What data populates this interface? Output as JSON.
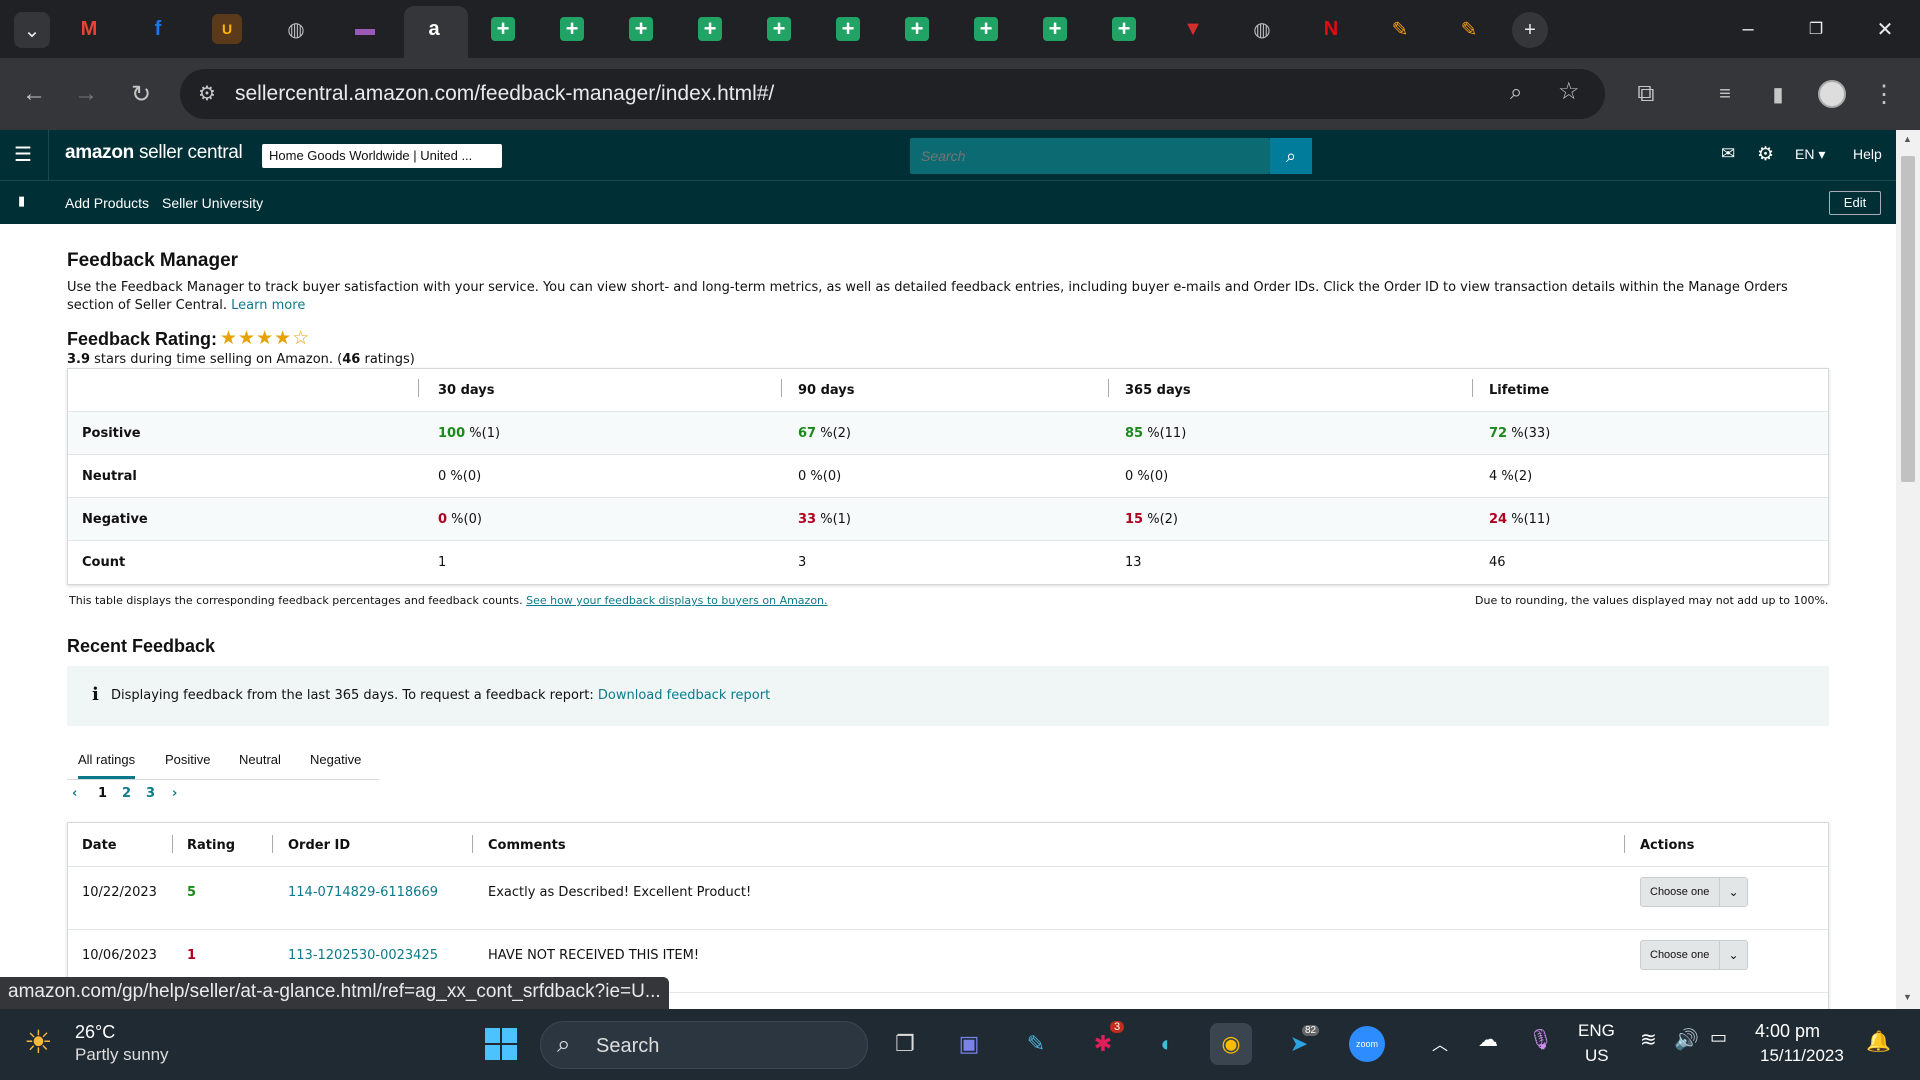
{
  "browser": {
    "url": "sellercentral.amazon.com/feedback-manager/index.html#/",
    "tabs": [
      "gmail-icon",
      "facebook-icon",
      "ups-icon",
      "globe-icon",
      "flag-icon",
      "amazon-icon",
      "sheets-icon",
      "sheets-icon",
      "sheets-icon",
      "sheets-icon",
      "sheets-icon",
      "sheets-icon",
      "sheets-icon",
      "sheets-icon",
      "sheets-icon",
      "sheets-icon",
      "bank-icon",
      "globe-icon",
      "netflix-icon",
      "pen-icon",
      "pen-icon"
    ],
    "colors": {
      "tabstrip": "#202124",
      "toolbar": "#35363a",
      "sheets": "#21a366"
    }
  },
  "header": {
    "logo_amazon": "amazon",
    "logo_suffix": "seller central",
    "store": "Home Goods Worldwide | United ...",
    "search_placeholder": "Search",
    "language": "EN",
    "help": "Help",
    "nav": [
      "Add Products",
      "Seller University"
    ],
    "edit": "Edit",
    "colors": {
      "bg": "#002f36",
      "search": "#0c6a72",
      "search_btn": "#017d9b"
    }
  },
  "page": {
    "title": "Feedback Manager",
    "intro": "Use the Feedback Manager to track buyer satisfaction with your service. You can view short- and long-term metrics, as well as detailed feedback entries, including buyer e-mails and Order IDs. Click the Order ID to view transaction details within the Manage Orders section of Seller Central.",
    "learn_more": "Learn more",
    "rating_title": "Feedback Rating:",
    "stars": "★★★★☆",
    "rating_value": "3.9",
    "rating_text": " stars during time selling on Amazon. (",
    "rating_count": "46",
    "rating_suffix": " ratings)"
  },
  "metrics": {
    "headers": [
      "30 days",
      "90 days",
      "365 days",
      "Lifetime"
    ],
    "rows": [
      {
        "label": "Positive",
        "cells": [
          {
            "v": "100",
            "r": " %(1)",
            "c": "green"
          },
          {
            "v": "67",
            "r": " %(2)",
            "c": "green"
          },
          {
            "v": "85",
            "r": " %(11)",
            "c": "green"
          },
          {
            "v": "72",
            "r": " %(33)",
            "c": "green"
          }
        ]
      },
      {
        "label": "Neutral",
        "cells": [
          {
            "v": "0",
            "r": " %(0)",
            "c": ""
          },
          {
            "v": "0",
            "r": " %(0)",
            "c": ""
          },
          {
            "v": "0",
            "r": " %(0)",
            "c": ""
          },
          {
            "v": "4",
            "r": " %(2)",
            "c": ""
          }
        ]
      },
      {
        "label": "Negative",
        "cells": [
          {
            "v": "0",
            "r": " %(0)",
            "c": "red"
          },
          {
            "v": "33",
            "r": " %(1)",
            "c": "red"
          },
          {
            "v": "15",
            "r": " %(2)",
            "c": "red"
          },
          {
            "v": "24",
            "r": " %(11)",
            "c": "red"
          }
        ]
      },
      {
        "label": "Count",
        "cells": [
          {
            "v": "1",
            "r": "",
            "c": ""
          },
          {
            "v": "3",
            "r": "",
            "c": ""
          },
          {
            "v": "13",
            "r": "",
            "c": ""
          },
          {
            "v": "46",
            "r": "",
            "c": ""
          }
        ]
      }
    ],
    "note_left": "This table displays the corresponding feedback percentages and feedback counts.",
    "note_left_link": "See how your feedback displays to buyers on Amazon.",
    "note_right": "Due to rounding, the values displayed may not add up to 100%."
  },
  "recent": {
    "title": "Recent Feedback",
    "info_icon": "i",
    "info": "Displaying feedback from the last 365 days. To request a feedback report: ",
    "info_link": "Download feedback report",
    "tabs": [
      "All ratings",
      "Positive",
      "Neutral",
      "Negative"
    ],
    "pages": [
      "1",
      "2",
      "3"
    ],
    "columns": [
      "Date",
      "Rating",
      "Order ID",
      "Comments",
      "Actions"
    ],
    "rows": [
      {
        "date": "10/22/2023",
        "rating": "5",
        "rating_color": "green",
        "order": "114-0714829-6118669",
        "comment": "Exactly as Described! Excellent Product!",
        "action": "Choose one"
      },
      {
        "date": "10/06/2023",
        "rating": "1",
        "rating_color": "red",
        "order": "113-1202530-0023425",
        "comment": "HAVE NOT RECEIVED THIS ITEM!",
        "action": "Choose one"
      }
    ]
  },
  "status_url": "amazon.com/gp/help/seller/at-a-glance.html/ref=ag_xx_cont_srfdback?ie=U...",
  "taskbar": {
    "temp": "26°C",
    "weather": "Partly sunny",
    "search": "Search",
    "lang1": "ENG",
    "lang2": "US",
    "time": "4:00 pm",
    "date": "15/11/2023",
    "slack_badge": "3",
    "telegram_badge": "82",
    "zoom_label": "zoom"
  }
}
